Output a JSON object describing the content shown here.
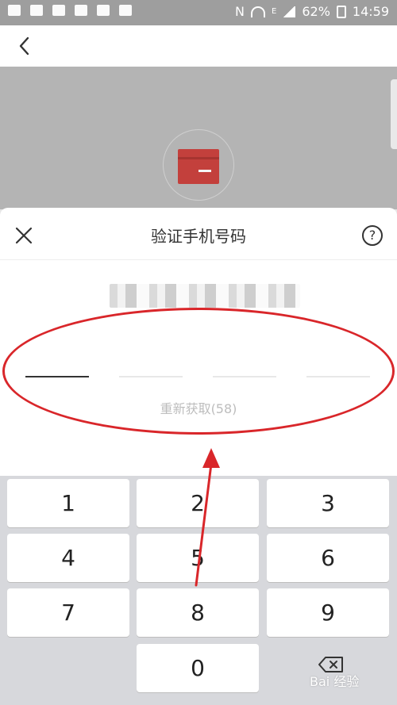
{
  "status_bar": {
    "battery": "62%",
    "time": "14:59",
    "n_label": "N",
    "e_label": "E"
  },
  "dialog": {
    "title": "验证手机号码",
    "help_symbol": "?"
  },
  "otp": {
    "resend_label": "重新获取(58)"
  },
  "keypad": {
    "keys": [
      "1",
      "2",
      "3",
      "4",
      "5",
      "6",
      "7",
      "8",
      "9",
      "0"
    ]
  },
  "watermark": {
    "text": "Bai 经验"
  },
  "colors": {
    "accent_red": "#d9262a",
    "card_red": "#c3403c"
  }
}
